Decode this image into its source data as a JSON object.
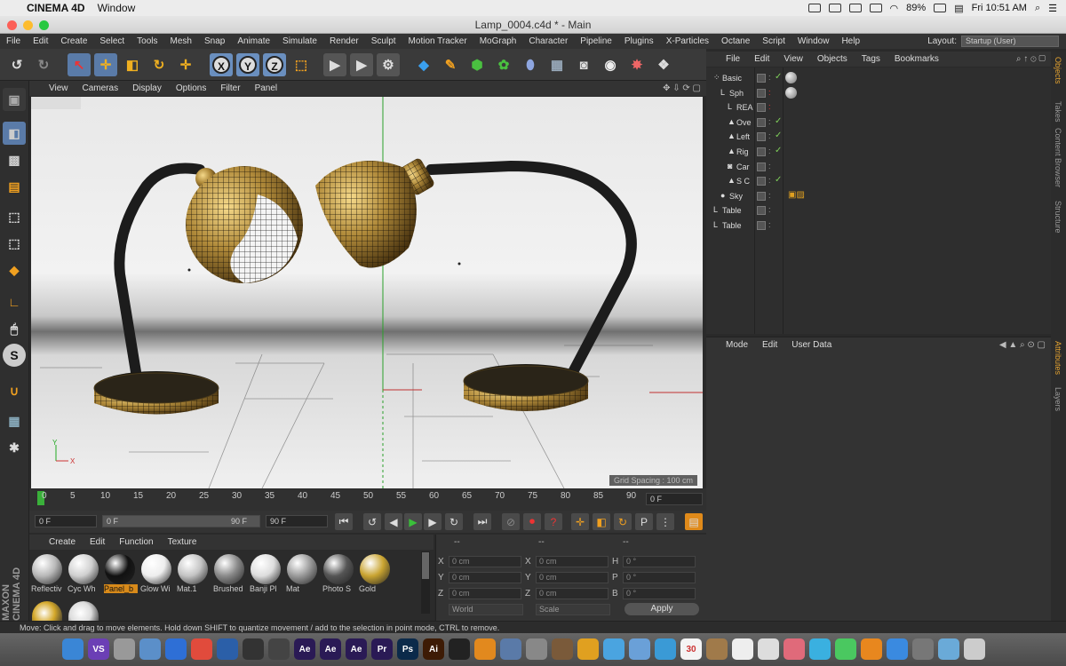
{
  "mac_menubar": {
    "app_name": "CINEMA 4D",
    "menus": [
      "Window"
    ],
    "battery": "89%",
    "clock": "Fri 10:51 AM"
  },
  "window": {
    "title": "Lamp_0004.c4d * - Main"
  },
  "main_menu": [
    "File",
    "Edit",
    "Create",
    "Select",
    "Tools",
    "Mesh",
    "Snap",
    "Animate",
    "Simulate",
    "Render",
    "Sculpt",
    "Motion Tracker",
    "MoGraph",
    "Character",
    "Pipeline",
    "Plugins",
    "X-Particles",
    "Octane",
    "Script",
    "Window",
    "Help"
  ],
  "layout": {
    "label": "Layout:",
    "value": "Startup (User)"
  },
  "viewport": {
    "menu": [
      "View",
      "Cameras",
      "Display",
      "Options",
      "Filter",
      "Panel"
    ],
    "grid_spacing": "Grid Spacing : 100 cm"
  },
  "timeline": {
    "ticks": [
      "0",
      "5",
      "10",
      "15",
      "20",
      "25",
      "30",
      "35",
      "40",
      "45",
      "50",
      "55",
      "60",
      "65",
      "70",
      "75",
      "80",
      "85",
      "90"
    ],
    "current_frame": "0 F"
  },
  "transport": {
    "start": "0 F",
    "range_start": "0 F",
    "range_end": "90 F",
    "end": "90 F"
  },
  "material_manager": {
    "menu": [
      "Create",
      "Edit",
      "Function",
      "Texture"
    ],
    "materials": [
      {
        "name": "Reflectiv",
        "color": "#b8b8b8"
      },
      {
        "name": "Cyc Wh",
        "color": "#d0d0d0"
      },
      {
        "name": "Panel_b",
        "color": "#111111"
      },
      {
        "name": "Glow Wi",
        "color": "#eeeeee"
      },
      {
        "name": "Mat.1",
        "color": "#c4c4c4"
      },
      {
        "name": "Brushed",
        "color": "#8a8a8a"
      },
      {
        "name": "Banji Pl",
        "color": "#dddddd"
      },
      {
        "name": "Mat",
        "color": "#9a9a9a"
      },
      {
        "name": "Photo S",
        "color": "#555555"
      },
      {
        "name": "Gold",
        "color": "#c9a431"
      }
    ],
    "selected_label_color": "#d88a1a"
  },
  "coordinates": {
    "headers": [
      "--",
      "--",
      "--"
    ],
    "rows": [
      {
        "a": "X",
        "av": "0 cm",
        "b": "X",
        "bv": "0 cm",
        "c": "H",
        "cv": "0 °"
      },
      {
        "a": "Y",
        "av": "0 cm",
        "b": "Y",
        "bv": "0 cm",
        "c": "P",
        "cv": "0 °"
      },
      {
        "a": "Z",
        "av": "0 cm",
        "b": "Z",
        "bv": "0 cm",
        "c": "B",
        "cv": "0 °"
      }
    ],
    "space": "World",
    "mode": "Scale",
    "apply": "Apply"
  },
  "object_manager": {
    "menu": [
      "File",
      "Edit",
      "View",
      "Objects",
      "Tags",
      "Bookmarks"
    ],
    "objects": [
      {
        "name": "Basic"
      },
      {
        "name": "Sph"
      },
      {
        "name": "REA"
      },
      {
        "name": "Ove"
      },
      {
        "name": "Left"
      },
      {
        "name": "Rig"
      },
      {
        "name": "Car"
      },
      {
        "name": "S C"
      },
      {
        "name": "Sky"
      },
      {
        "name": "Table"
      },
      {
        "name": "Table"
      }
    ]
  },
  "attributes": {
    "menu": [
      "Mode",
      "Edit",
      "User Data"
    ]
  },
  "right_tabs": {
    "top": [
      "Objects",
      "Takes",
      "Content Browser",
      "Structure"
    ],
    "bottom": [
      "Attributes",
      "Layers"
    ]
  },
  "status": "Move: Click and drag to move elements. Hold down SHIFT to quantize movement / add to the selection in point mode, CTRL to remove.",
  "maxon_logo": "MAXON CINEMA 4D",
  "dock": {
    "items": [
      {
        "label": "",
        "color": "#3a86d6"
      },
      {
        "label": "VS",
        "color": "#6b3fb5"
      },
      {
        "label": "",
        "color": "#999999"
      },
      {
        "label": "",
        "color": "#5b8fc9"
      },
      {
        "label": "",
        "color": "#2e6fd6"
      },
      {
        "label": "",
        "color": "#e14b3c"
      },
      {
        "label": "",
        "color": "#2b5fa8"
      },
      {
        "label": "",
        "color": "#333333"
      },
      {
        "label": "",
        "color": "#444444"
      },
      {
        "label": "Ae",
        "color": "#2a1a55"
      },
      {
        "label": "Ae",
        "color": "#2a1a55"
      },
      {
        "label": "Ae",
        "color": "#2a1a55"
      },
      {
        "label": "Pr",
        "color": "#2a1a55"
      },
      {
        "label": "Ps",
        "color": "#0b2a4a"
      },
      {
        "label": "Ai",
        "color": "#3d1b05"
      },
      {
        "label": "",
        "color": "#222222"
      },
      {
        "label": "",
        "color": "#e2891e"
      },
      {
        "label": "",
        "color": "#5a7aa8"
      },
      {
        "label": "",
        "color": "#888888"
      },
      {
        "label": "",
        "color": "#7a5a3a"
      },
      {
        "label": "",
        "color": "#e0a020"
      },
      {
        "label": "",
        "color": "#4aa4e0"
      },
      {
        "label": "",
        "color": "#6aa0d8"
      },
      {
        "label": "",
        "color": "#3a9ad6"
      },
      {
        "label": "30",
        "color": "#f4f4f4"
      },
      {
        "label": "",
        "color": "#a07a4a"
      },
      {
        "label": "",
        "color": "#eeeeee"
      },
      {
        "label": "",
        "color": "#dddddd"
      },
      {
        "label": "",
        "color": "#e06a7a"
      },
      {
        "label": "",
        "color": "#3ab0e0"
      },
      {
        "label": "",
        "color": "#4ac860"
      },
      {
        "label": "",
        "color": "#e8871e"
      },
      {
        "label": "",
        "color": "#3a8ae0"
      },
      {
        "label": "",
        "color": "#777777"
      },
      {
        "label": "",
        "color": "#6aaad8"
      },
      {
        "label": "",
        "color": "#cccccc"
      }
    ]
  }
}
